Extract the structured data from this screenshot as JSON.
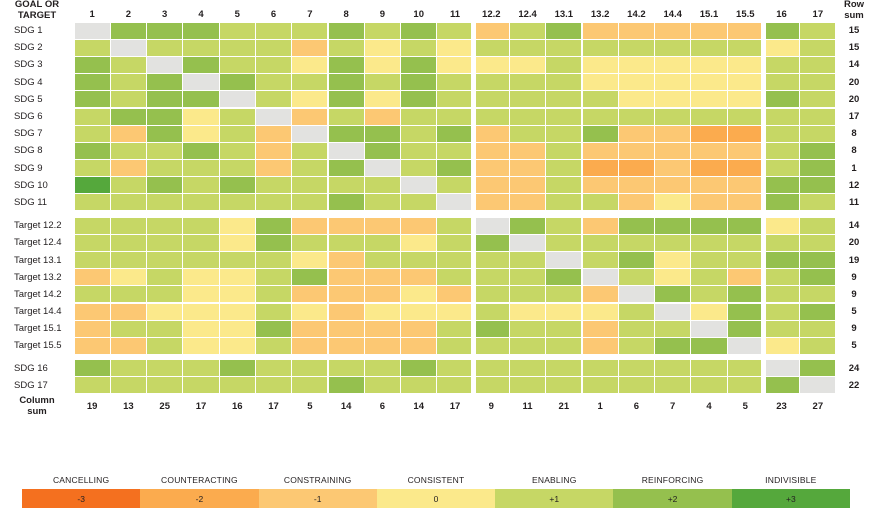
{
  "header": {
    "corner_label_line1": "GOAL OR",
    "corner_label_line2": "TARGET",
    "row_sum_line1": "Row",
    "row_sum_line2": "sum",
    "column_sum_line1": "Column",
    "column_sum_line2": "sum"
  },
  "columns": [
    "1",
    "2",
    "3",
    "4",
    "5",
    "6",
    "7",
    "8",
    "9",
    "10",
    "11",
    "12.2",
    "12.4",
    "13.1",
    "13.2",
    "14.2",
    "14.4",
    "15.1",
    "15.5",
    "16",
    "17"
  ],
  "rows": [
    "SDG 1",
    "SDG 2",
    "SDG 3",
    "SDG 4",
    "SDG 5",
    "SDG 6",
    "SDG 7",
    "SDG 8",
    "SDG 9",
    "SDG 10",
    "SDG 11",
    "Target 12.2",
    "Target 12.4",
    "Target 13.1",
    "Target 13.2",
    "Target 14.2",
    "Target 14.4",
    "Target 15.1",
    "Target 15.5",
    "SDG 16",
    "SDG 17"
  ],
  "row_sums": [
    15,
    15,
    14,
    20,
    20,
    17,
    8,
    8,
    1,
    12,
    11,
    14,
    20,
    19,
    9,
    9,
    5,
    9,
    5,
    24,
    22
  ],
  "column_sums": [
    19,
    13,
    25,
    17,
    16,
    17,
    5,
    14,
    6,
    14,
    17,
    9,
    11,
    21,
    1,
    6,
    7,
    4,
    5,
    23,
    27
  ],
  "legend": {
    "labels": [
      "CANCELLING",
      "COUNTERACTING",
      "CONSTRAINING",
      "CONSISTENT",
      "ENABLING",
      "REINFORCING",
      "INDIVISIBLE"
    ],
    "values": [
      "-3",
      "-2",
      "-1",
      "0",
      "+1",
      "+2",
      "+3"
    ],
    "colors": [
      "#f4701f",
      "#fbab4e",
      "#fcc873",
      "#fbe98b",
      "#c6d765",
      "#95c04e",
      "#55a83c"
    ]
  },
  "palette": {
    "-3": "#f4701f",
    "-2": "#fbab4e",
    "-1": "#fcc873",
    "0": "#fbe98b",
    "1": "#c6d765",
    "2": "#95c04e",
    "3": "#55a83c",
    "diagonal": "#e2e2e0",
    "blank": "#ffffff"
  },
  "chart_data": {
    "type": "heatmap",
    "title": "SDG goal and target interaction matrix",
    "xlabel": "GOAL OR TARGET",
    "ylabel": "GOAL OR TARGET",
    "legend_position": "bottom",
    "scale_min": -3,
    "scale_max": 3,
    "scale_labels": {
      "-3": "CANCELLING",
      "-2": "COUNTERACTING",
      "-1": "CONSTRAINING",
      "0": "CONSISTENT",
      "1": "ENABLING",
      "2": "REINFORCING",
      "3": "INDIVISIBLE"
    },
    "x_categories": [
      "1",
      "2",
      "3",
      "4",
      "5",
      "6",
      "7",
      "8",
      "9",
      "10",
      "11",
      "12.2",
      "12.4",
      "13.1",
      "13.2",
      "14.2",
      "14.4",
      "15.1",
      "15.5",
      "16",
      "17"
    ],
    "y_categories": [
      "SDG 1",
      "SDG 2",
      "SDG 3",
      "SDG 4",
      "SDG 5",
      "SDG 6",
      "SDG 7",
      "SDG 8",
      "SDG 9",
      "SDG 10",
      "SDG 11",
      "Target 12.2",
      "Target 12.4",
      "Target 13.1",
      "Target 13.2",
      "Target 14.2",
      "Target 14.4",
      "Target 15.1",
      "Target 15.5",
      "SDG 16",
      "SDG 17"
    ],
    "null_token": "D",
    "blank_token": "X",
    "values": [
      [
        "D",
        2,
        2,
        2,
        1,
        1,
        1,
        2,
        1,
        2,
        1,
        -1,
        1,
        2,
        -1,
        -1,
        -1,
        -1,
        -1,
        2,
        1
      ],
      [
        1,
        "D",
        1,
        1,
        1,
        1,
        -1,
        1,
        0,
        1,
        0,
        1,
        1,
        1,
        1,
        1,
        1,
        1,
        1,
        0,
        1
      ],
      [
        2,
        1,
        "D",
        2,
        1,
        1,
        0,
        2,
        0,
        2,
        0,
        0,
        0,
        1,
        0,
        0,
        0,
        0,
        0,
        1,
        1
      ],
      [
        2,
        1,
        2,
        "D",
        2,
        1,
        1,
        2,
        1,
        2,
        1,
        1,
        1,
        1,
        0,
        0,
        0,
        0,
        0,
        1,
        1
      ],
      [
        2,
        1,
        2,
        2,
        "D",
        1,
        0,
        2,
        0,
        2,
        1,
        1,
        1,
        1,
        1,
        0,
        0,
        0,
        0,
        2,
        1
      ],
      [
        1,
        2,
        2,
        0,
        1,
        "D",
        -1,
        1,
        -1,
        1,
        1,
        1,
        1,
        1,
        1,
        1,
        1,
        1,
        1,
        1,
        1
      ],
      [
        1,
        -1,
        2,
        0,
        1,
        -1,
        "D",
        2,
        2,
        1,
        2,
        -1,
        1,
        1,
        2,
        -1,
        -1,
        -2,
        -2,
        1,
        1
      ],
      [
        2,
        1,
        1,
        2,
        1,
        -1,
        1,
        "D",
        2,
        1,
        1,
        -1,
        -1,
        1,
        -1,
        -1,
        -1,
        -1,
        -1,
        1,
        2
      ],
      [
        1,
        -1,
        1,
        1,
        1,
        -1,
        1,
        2,
        "D",
        1,
        2,
        -1,
        -1,
        1,
        -2,
        -2,
        -1,
        -2,
        -2,
        1,
        2
      ],
      [
        3,
        1,
        2,
        1,
        2,
        1,
        1,
        1,
        1,
        "D",
        1,
        -1,
        -1,
        1,
        -1,
        -1,
        -1,
        -1,
        -1,
        2,
        2
      ],
      [
        1,
        1,
        1,
        1,
        1,
        1,
        1,
        2,
        1,
        1,
        "D",
        -1,
        -1,
        1,
        1,
        -1,
        0,
        -1,
        -1,
        2,
        1
      ],
      [
        1,
        1,
        1,
        1,
        0,
        2,
        -1,
        -1,
        -1,
        -1,
        1,
        "D",
        2,
        1,
        -1,
        2,
        2,
        2,
        2,
        0,
        1
      ],
      [
        1,
        1,
        1,
        1,
        0,
        2,
        1,
        1,
        1,
        0,
        1,
        2,
        "D",
        1,
        1,
        1,
        1,
        1,
        1,
        1,
        1
      ],
      [
        1,
        1,
        1,
        1,
        1,
        1,
        0,
        -1,
        1,
        1,
        1,
        1,
        1,
        "D",
        1,
        2,
        0,
        1,
        1,
        2,
        2
      ],
      [
        -1,
        0,
        1,
        0,
        0,
        1,
        2,
        -1,
        -1,
        -1,
        1,
        1,
        1,
        2,
        "D",
        1,
        0,
        1,
        -1,
        1,
        2
      ],
      [
        1,
        1,
        1,
        0,
        0,
        1,
        -1,
        -1,
        -1,
        0,
        -1,
        1,
        1,
        1,
        -1,
        "D",
        2,
        1,
        2,
        1,
        1
      ],
      [
        -1,
        -1,
        0,
        0,
        0,
        1,
        0,
        -1,
        0,
        0,
        0,
        1,
        0,
        0,
        0,
        1,
        "D",
        0,
        2,
        1,
        2
      ],
      [
        -1,
        1,
        1,
        0,
        0,
        2,
        -1,
        -1,
        -1,
        -1,
        1,
        2,
        1,
        1,
        -1,
        1,
        1,
        "D",
        2,
        1,
        1
      ],
      [
        -1,
        -1,
        1,
        0,
        0,
        1,
        -1,
        -1,
        -1,
        -1,
        1,
        1,
        1,
        1,
        -1,
        1,
        2,
        2,
        "D",
        0,
        1
      ],
      [
        2,
        1,
        1,
        1,
        2,
        1,
        1,
        1,
        1,
        2,
        1,
        1,
        1,
        1,
        1,
        1,
        1,
        1,
        1,
        "D",
        2
      ],
      [
        1,
        1,
        1,
        1,
        1,
        1,
        1,
        2,
        1,
        1,
        1,
        1,
        1,
        1,
        1,
        1,
        1,
        1,
        1,
        2,
        "D"
      ]
    ]
  }
}
